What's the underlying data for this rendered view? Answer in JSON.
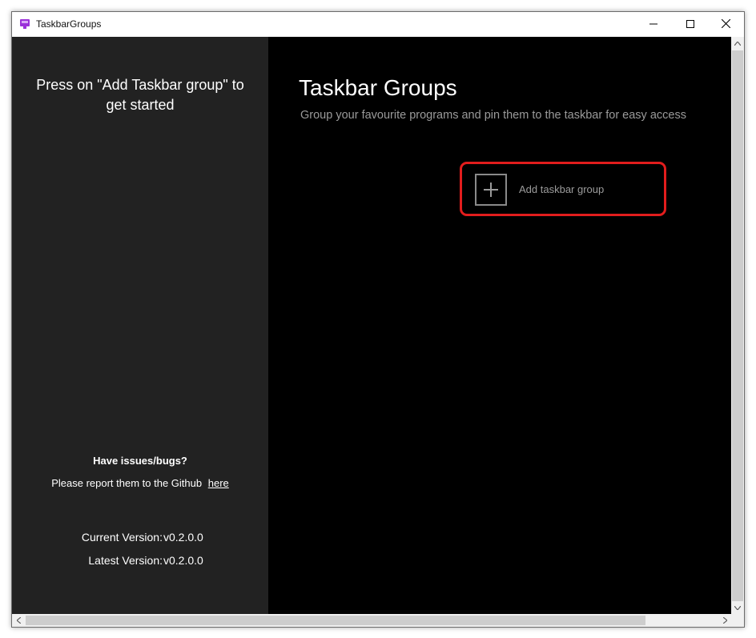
{
  "window": {
    "title": "TaskbarGroups",
    "icon": "taskbar-groups-app-icon",
    "controls": [
      "minimize-icon",
      "maximize-icon",
      "close-icon"
    ]
  },
  "sidebar": {
    "hint": "Press on \"Add Taskbar group\" to get started",
    "issues_title": "Have issues/bugs?",
    "issues_text": "Please report them to the Github",
    "issues_link": "here",
    "current_version_label": "Current Version:",
    "current_version": "v0.2.0.0",
    "latest_version_label": "Latest Version:",
    "latest_version": "v0.2.0.0"
  },
  "main": {
    "title": "Taskbar Groups",
    "subtitle": "Group your favourite programs and pin them to the taskbar for easy access",
    "add_label": "Add taskbar group"
  },
  "colors": {
    "sidebar_bg": "#222222",
    "main_bg": "#000000",
    "highlight": "#e21d1d",
    "app_icon": "#9b30d9"
  }
}
